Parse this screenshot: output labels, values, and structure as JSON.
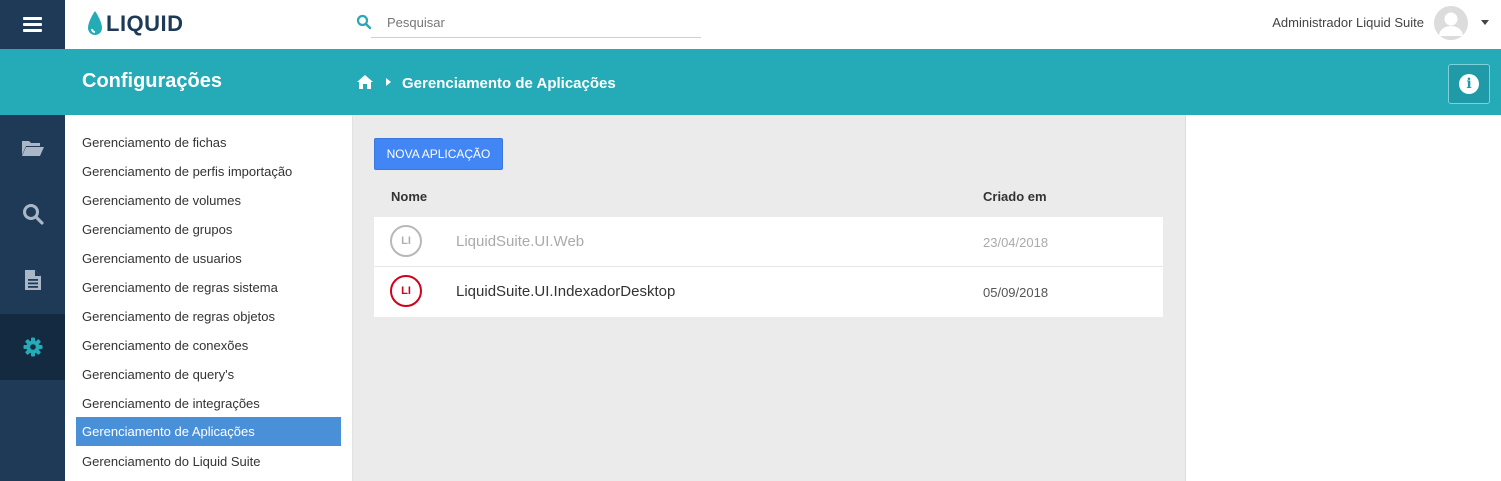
{
  "header": {
    "logo_text": "LIQUID",
    "search_placeholder": "Pesquisar",
    "user_name": "Administrador Liquid Suite"
  },
  "titlebar": {
    "section_title": "Configurações",
    "breadcrumb_current": "Gerenciamento de Aplicações"
  },
  "iconbar": {
    "items": [
      "folder-open-icon",
      "search-icon",
      "document-icon",
      "gear-icon"
    ],
    "active": "gear-icon"
  },
  "menu": {
    "items": [
      {
        "label": "Gerenciamento de fichas"
      },
      {
        "label": "Gerenciamento de perfis importação"
      },
      {
        "label": "Gerenciamento de volumes"
      },
      {
        "label": "Gerenciamento de grupos"
      },
      {
        "label": "Gerenciamento de usuarios"
      },
      {
        "label": "Gerenciamento de regras sistema"
      },
      {
        "label": "Gerenciamento de regras objetos"
      },
      {
        "label": "Gerenciamento de conexões"
      },
      {
        "label": "Gerenciamento de query's"
      },
      {
        "label": "Gerenciamento de integrações"
      },
      {
        "label": "Gerenciamento de Aplicações",
        "active": true
      },
      {
        "label": "Gerenciamento do Liquid Suite"
      }
    ]
  },
  "main": {
    "new_button": "NOVA APLICAÇÃO",
    "columns": {
      "name": "Nome",
      "created": "Criado em"
    },
    "rows": [
      {
        "initials": "LI",
        "name": "LiquidSuite.UI.Web",
        "created": "23/04/2018",
        "state": "disabled"
      },
      {
        "initials": "LI",
        "name": "LiquidSuite.UI.IndexadorDesktop",
        "created": "05/09/2018",
        "state": "enabled"
      }
    ]
  },
  "colors": {
    "navy": "#1e3a57",
    "teal": "#25aab7",
    "primary_button": "#4285f4",
    "active_menu": "#4a90d9",
    "enabled_badge": "#d0021b"
  }
}
